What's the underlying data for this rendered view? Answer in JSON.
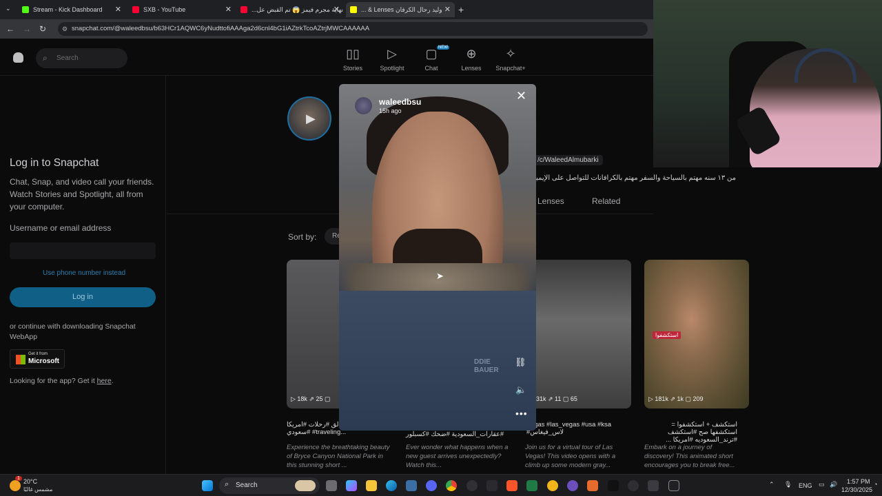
{
  "browser": {
    "tabs": [
      {
        "title": "Stream - Kick Dashboard",
        "color": "#53fc18",
        "active": false
      },
      {
        "title": "SXB - YouTube",
        "color": "#ff0033",
        "active": false
      },
      {
        "title": "نهاية مجرم فيمز 😱 تم القبض عل...",
        "color": "#ff0033",
        "active": false
      },
      {
        "title": "وليد رحال الكرفان Lenses & ...",
        "color": "#fffc00",
        "active": true
      }
    ],
    "url": "snapchat.com/@waleedbsu/b63HCr1AQWC6yNudttofiAAAga2d6cnl4bG1iAZtrkTcoAZtrjMWCAAAAAA"
  },
  "nav": {
    "search_placeholder": "Search",
    "items": [
      {
        "label": "Stories",
        "icon": "stories-icon"
      },
      {
        "label": "Spotlight",
        "icon": "spotlight-icon"
      },
      {
        "label": "Chat",
        "icon": "chat-icon",
        "badge": "NEW"
      },
      {
        "label": "Lenses",
        "icon": "lenses-icon"
      },
      {
        "label": "Snapchat+",
        "icon": "snapchat-plus-icon"
      }
    ]
  },
  "sidebar": {
    "title": "Log in to Snapchat",
    "subtitle": "Chat, Snap, and video call your friends. Watch Stories and Spotlight, all from your computer.",
    "username_label": "Username or email address",
    "phone_link": "Use phone number instead",
    "login_button": "Log in",
    "continue_text": "or continue with downloading Snapchat WebApp",
    "ms_badge_top": "Get it from",
    "ms_badge_bottom": "Microsoft",
    "app_text": "Looking for the app? Get it",
    "app_link": "here"
  },
  "profile": {
    "link_text": "/c/WaleedAlmubarki",
    "bio": "من ١٣ سنه مهتم بالسياحة والسفر مهتم بالكرافانات للتواصل على الإيميل us",
    "tabs": [
      "Lenses",
      "Related"
    ],
    "sort_label": "Sort by:",
    "sort_value": "Re"
  },
  "cards": [
    {
      "stats": "▷ 18k  ⇗ 25  ▢",
      "caption": "سبحان الخالق #رحلات #امريكا #سعودي #traveling...",
      "desc": "Experience the breathtaking beauty of Bryce Canyon National Park in this stunning short ..."
    },
    {
      "stats": "",
      "caption": "#عقارات_السعودية #ضحك #كسبلور",
      "desc": "Ever wonder what happens when a new guest arrives unexpectedly? Watch this..."
    },
    {
      "stats": "31k  ⇗ 11  ▢ 65",
      "caption": "Vegas #las_vegas #usa #ksa #لاس_فيغاس",
      "desc": "Join us for a virtual tour of Las Vegas! This video opens with a climb up some modern gray..."
    },
    {
      "stats": "▷ 181k  ⇗ 1k  ▢ 209",
      "caption": "استكشف + استكشفوا = استكشفها صح #استكشف #ترند_السعوديه #امريكا ...",
      "desc": "Embark on a journey of discovery! This animated short encourages you to break free..."
    }
  ],
  "modal": {
    "username": "waleedbsu",
    "time": "15h ago",
    "card_tag": "استكشفوا",
    "jacket_text": "DDIE BAUER"
  },
  "taskbar": {
    "weather_temp": "20°C",
    "weather_desc": "مشمس غالبًا",
    "search_label": "Search",
    "language": "ENG",
    "time": "1:57 PM",
    "date": "12/30/2025",
    "weather_badge": "1"
  }
}
